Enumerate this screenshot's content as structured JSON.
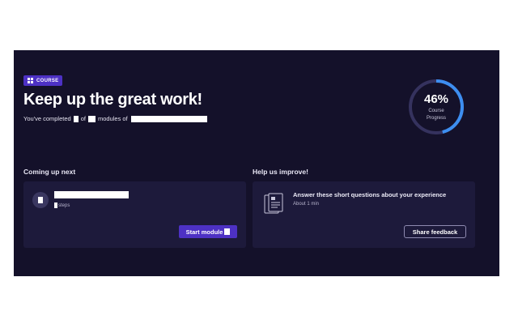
{
  "header": {
    "badge": "COURSE",
    "title": "Keep up the great work!",
    "subtitle": {
      "prefix": "You've completed",
      "of1": "of",
      "modules_of": "modules of"
    }
  },
  "progress": {
    "percent_label": "46%",
    "value": 0.46,
    "label_line1": "Course",
    "label_line2": "Progress",
    "track_color": "#35325e",
    "fill_color": "#3d8ef0"
  },
  "coming_up": {
    "heading": "Coming up next",
    "steps_label": "steps",
    "button_label": "Start module"
  },
  "feedback": {
    "heading": "Help us improve!",
    "question": "Answer these short questions about your experience",
    "duration": "About 1 min",
    "button_label": "Share feedback"
  },
  "colors": {
    "background": "#14112a",
    "card": "#1d1a3b",
    "accent": "#4d31c4"
  }
}
